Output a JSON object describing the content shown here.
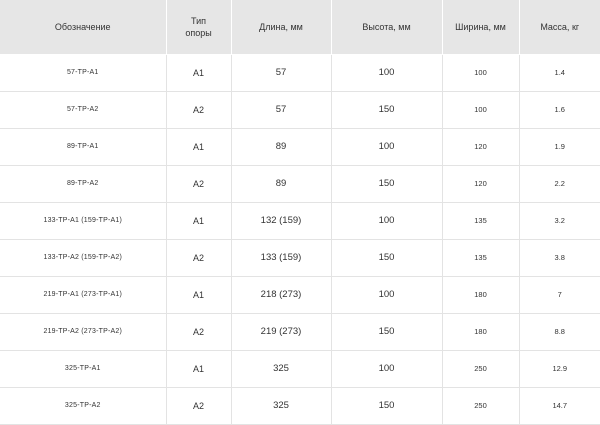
{
  "table": {
    "headers": {
      "designation": "Обозначение",
      "support_line1": "Тип",
      "support_line2": "опоры",
      "length": "Длина, мм",
      "height": "Высота, мм",
      "width": "Ширина, мм",
      "mass": "Масса, кг"
    },
    "rows": [
      {
        "designation": "57-TP-A1",
        "support": "A1",
        "length": "57",
        "height": "100",
        "width": "100",
        "mass": "1.4"
      },
      {
        "designation": "57-TP-A2",
        "support": "A2",
        "length": "57",
        "height": "150",
        "width": "100",
        "mass": "1.6"
      },
      {
        "designation": "89-TP-A1",
        "support": "A1",
        "length": "89",
        "height": "100",
        "width": "120",
        "mass": "1.9"
      },
      {
        "designation": "89-TP-A2",
        "support": "A2",
        "length": "89",
        "height": "150",
        "width": "120",
        "mass": "2.2"
      },
      {
        "designation": "133-TP-A1 (159-TP-A1)",
        "support": "A1",
        "length": "132 (159)",
        "height": "100",
        "width": "135",
        "mass": "3.2"
      },
      {
        "designation": "133-TP-A2 (159-TP-A2)",
        "support": "A2",
        "length": "133 (159)",
        "height": "150",
        "width": "135",
        "mass": "3.8"
      },
      {
        "designation": "219-TP-A1 (273-TP-A1)",
        "support": "A1",
        "length": "218 (273)",
        "height": "100",
        "width": "180",
        "mass": "7"
      },
      {
        "designation": "219-TP-A2 (273-TP-A2)",
        "support": "A2",
        "length": "219 (273)",
        "height": "150",
        "width": "180",
        "mass": "8.8"
      },
      {
        "designation": "325-TP-A1",
        "support": "A1",
        "length": "325",
        "height": "100",
        "width": "250",
        "mass": "12.9"
      },
      {
        "designation": "325-TP-A2",
        "support": "A2",
        "length": "325",
        "height": "150",
        "width": "250",
        "mass": "14.7"
      }
    ]
  }
}
